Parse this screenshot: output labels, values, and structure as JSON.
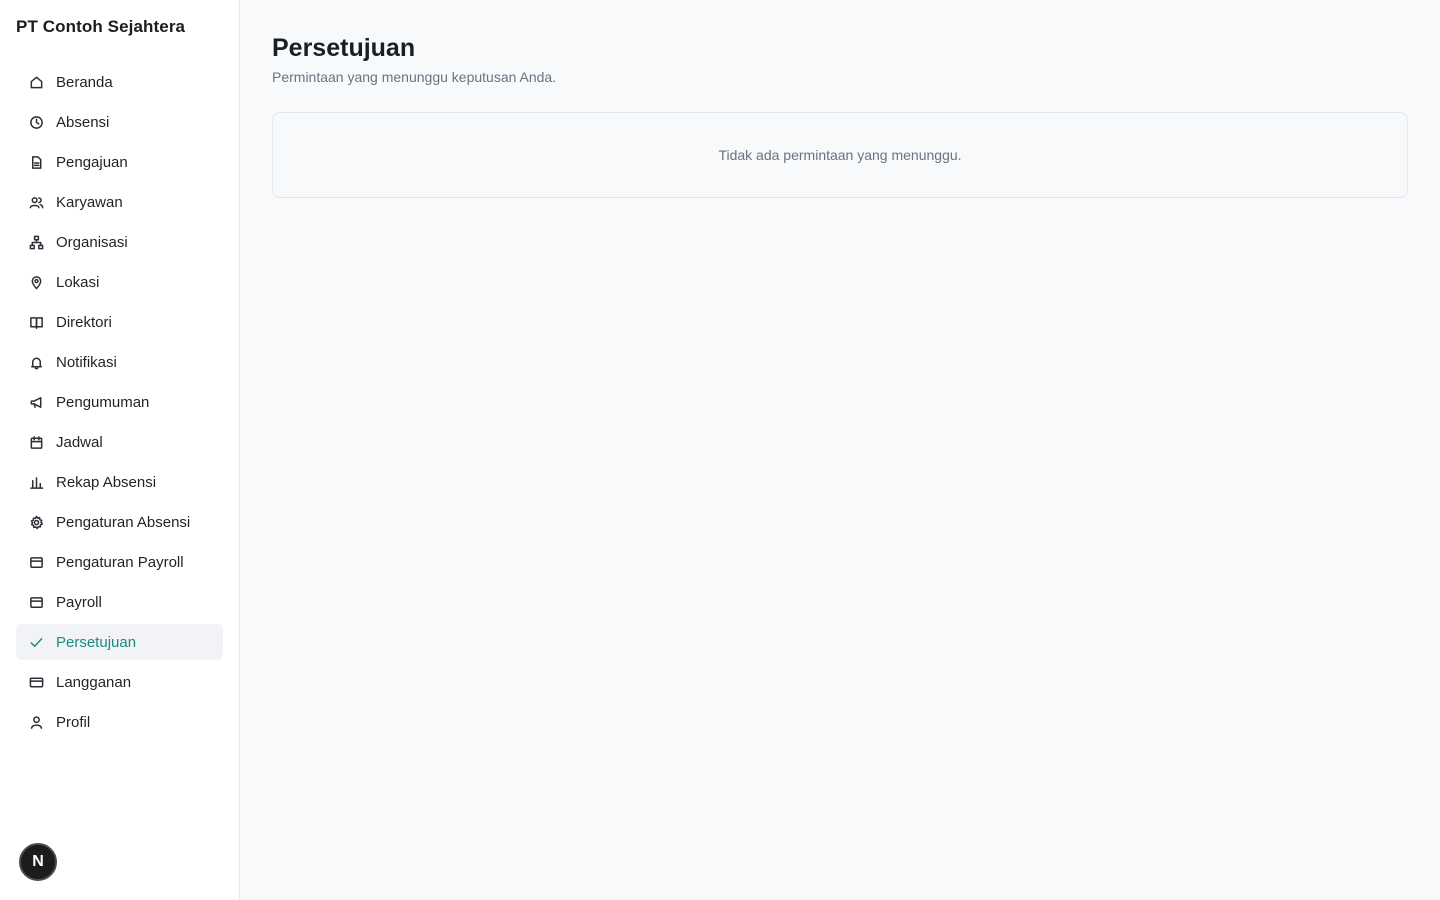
{
  "app": {
    "company_name": "PT Contoh Sejahtera"
  },
  "sidebar": {
    "items": [
      {
        "label": "Beranda",
        "icon": "home-icon"
      },
      {
        "label": "Absensi",
        "icon": "clock-icon"
      },
      {
        "label": "Pengajuan",
        "icon": "file-icon"
      },
      {
        "label": "Karyawan",
        "icon": "users-icon"
      },
      {
        "label": "Organisasi",
        "icon": "org-chart-icon"
      },
      {
        "label": "Lokasi",
        "icon": "map-pin-icon"
      },
      {
        "label": "Direktori",
        "icon": "book-icon"
      },
      {
        "label": "Notifikasi",
        "icon": "bell-icon"
      },
      {
        "label": "Pengumuman",
        "icon": "megaphone-icon"
      },
      {
        "label": "Jadwal",
        "icon": "calendar-icon"
      },
      {
        "label": "Rekap Absensi",
        "icon": "bar-chart-icon"
      },
      {
        "label": "Pengaturan Absensi",
        "icon": "gear-icon"
      },
      {
        "label": "Pengaturan Payroll",
        "icon": "wallet-icon"
      },
      {
        "label": "Payroll",
        "icon": "wallet-icon"
      },
      {
        "label": "Persetujuan",
        "icon": "check-icon",
        "active": true
      },
      {
        "label": "Langganan",
        "icon": "credit-card-icon"
      },
      {
        "label": "Profil",
        "icon": "user-icon"
      }
    ],
    "avatar_letter": "N"
  },
  "main": {
    "title": "Persetujuan",
    "subtitle": "Permintaan yang menunggu keputusan Anda.",
    "empty_message": "Tidak ada permintaan yang menunggu."
  },
  "colors": {
    "accent": "#1b8a83",
    "active_bg": "#f1f3f6"
  }
}
